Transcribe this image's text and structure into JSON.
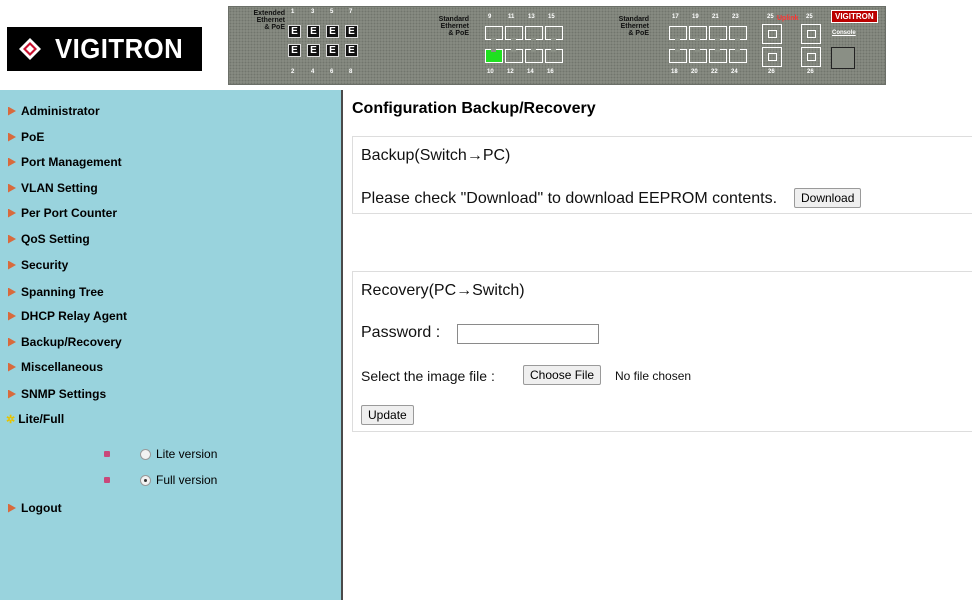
{
  "header": {
    "logo_text": "VIGITRON",
    "panel": {
      "extended_label": "Extended\nEthernet\n& PoE",
      "standard_label_1": "Standard\nEthernet\n& PoE",
      "standard_label_2": "Standard\nEthernet\n& PoE",
      "uplink_label": "Uplink",
      "console_label": "Console",
      "brand_badge": "VIGITRON",
      "ext_top_nums": [
        "1",
        "3",
        "5",
        "7"
      ],
      "ext_bot_nums": [
        "2",
        "4",
        "6",
        "8"
      ],
      "ext_port_glyph": "E",
      "std1_top_nums": [
        "9",
        "11",
        "13",
        "15"
      ],
      "std1_bot_nums": [
        "10",
        "12",
        "14",
        "16"
      ],
      "std2_top_nums": [
        "17",
        "19",
        "21",
        "23"
      ],
      "std2_bot_nums": [
        "18",
        "20",
        "22",
        "24"
      ],
      "uplink_top_nums": [
        "25",
        "25"
      ],
      "uplink_bot_nums": [
        "26",
        "26"
      ],
      "active_port_color": "#20e020"
    }
  },
  "sidebar": {
    "items": [
      {
        "label": "Administrator"
      },
      {
        "label": "PoE"
      },
      {
        "label": "Port Management"
      },
      {
        "label": "VLAN Setting"
      },
      {
        "label": "Per Port Counter"
      },
      {
        "label": "QoS Setting"
      },
      {
        "label": "Security"
      },
      {
        "label": "Spanning Tree"
      },
      {
        "label": "DHCP Relay Agent"
      },
      {
        "label": "Backup/Recovery"
      },
      {
        "label": "Miscellaneous"
      },
      {
        "label": "SNMP Settings"
      },
      {
        "label": "Lite/Full"
      }
    ],
    "version_options": [
      {
        "label": "Lite version",
        "checked": false
      },
      {
        "label": "Full version",
        "checked": true
      }
    ],
    "logout_label": "Logout",
    "background_color": "#99d3dd"
  },
  "main": {
    "title": "Configuration Backup/Recovery",
    "backup": {
      "title": "Backup(Switch→PC)",
      "instruction": "Please check \"Download\" to download EEPROM contents.",
      "download_button": "Download"
    },
    "recovery": {
      "title": "Recovery(PC→Switch)",
      "password_label": "Password :",
      "password_value": "",
      "file_label": "Select the image file :",
      "choose_file_button": "Choose File",
      "no_file_text": "No file chosen",
      "update_button": "Update"
    }
  }
}
